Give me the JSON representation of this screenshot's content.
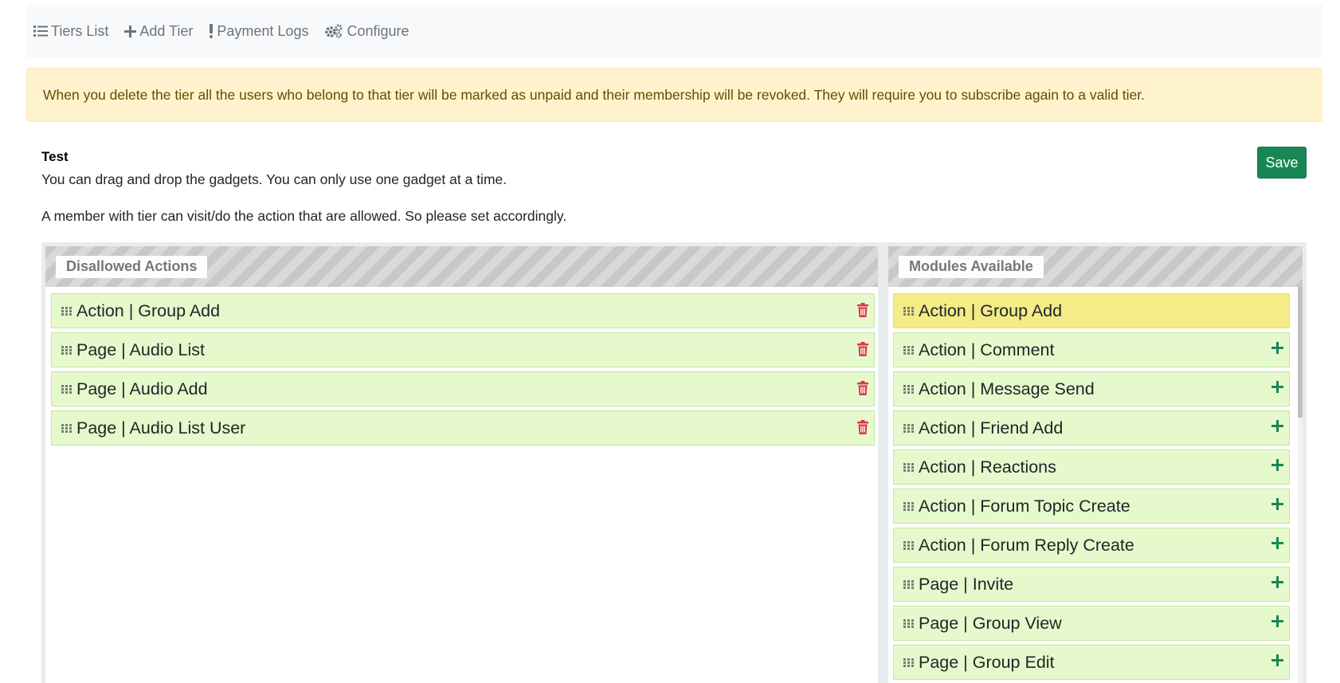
{
  "nav": {
    "items": [
      {
        "label": "Tiers List",
        "icon": "list-icon"
      },
      {
        "label": "Add Tier",
        "icon": "plus-icon"
      },
      {
        "label": "Payment Logs",
        "icon": "exclamation-icon"
      },
      {
        "label": "Configure",
        "icon": "gears-icon"
      }
    ]
  },
  "alert": {
    "text": "When you delete the tier all the users who belong to that tier will be marked as unpaid and their membership will be revoked. They will require you to subscribe again to a valid tier."
  },
  "tier": {
    "title": "Test",
    "description_1": "You can drag and drop the gadgets. You can only use one gadget at a time.",
    "description_2": "A member with tier can visit/do the action that are allowed. So please set accordingly."
  },
  "toolbar": {
    "save_label": "Save"
  },
  "disallowed": {
    "title": "Disallowed Actions",
    "items": [
      "Action | Group Add",
      "Page | Audio List",
      "Page | Audio Add",
      "Page | Audio List User"
    ]
  },
  "modules": {
    "title": "Modules Available",
    "items": [
      "Action | Group Add",
      "Action | Comment",
      "Action | Message Send",
      "Action | Friend Add",
      "Action | Reactions",
      "Action | Forum Topic Create",
      "Action | Forum Reply Create",
      "Page | Invite",
      "Page | Group View",
      "Page | Group Edit"
    ]
  },
  "colors": {
    "item_bg": "#e6f9cc",
    "item_highlight": "#f3ec87",
    "delete_red": "#dc3545",
    "add_green": "#198754",
    "alert_bg": "#fff3cd"
  }
}
